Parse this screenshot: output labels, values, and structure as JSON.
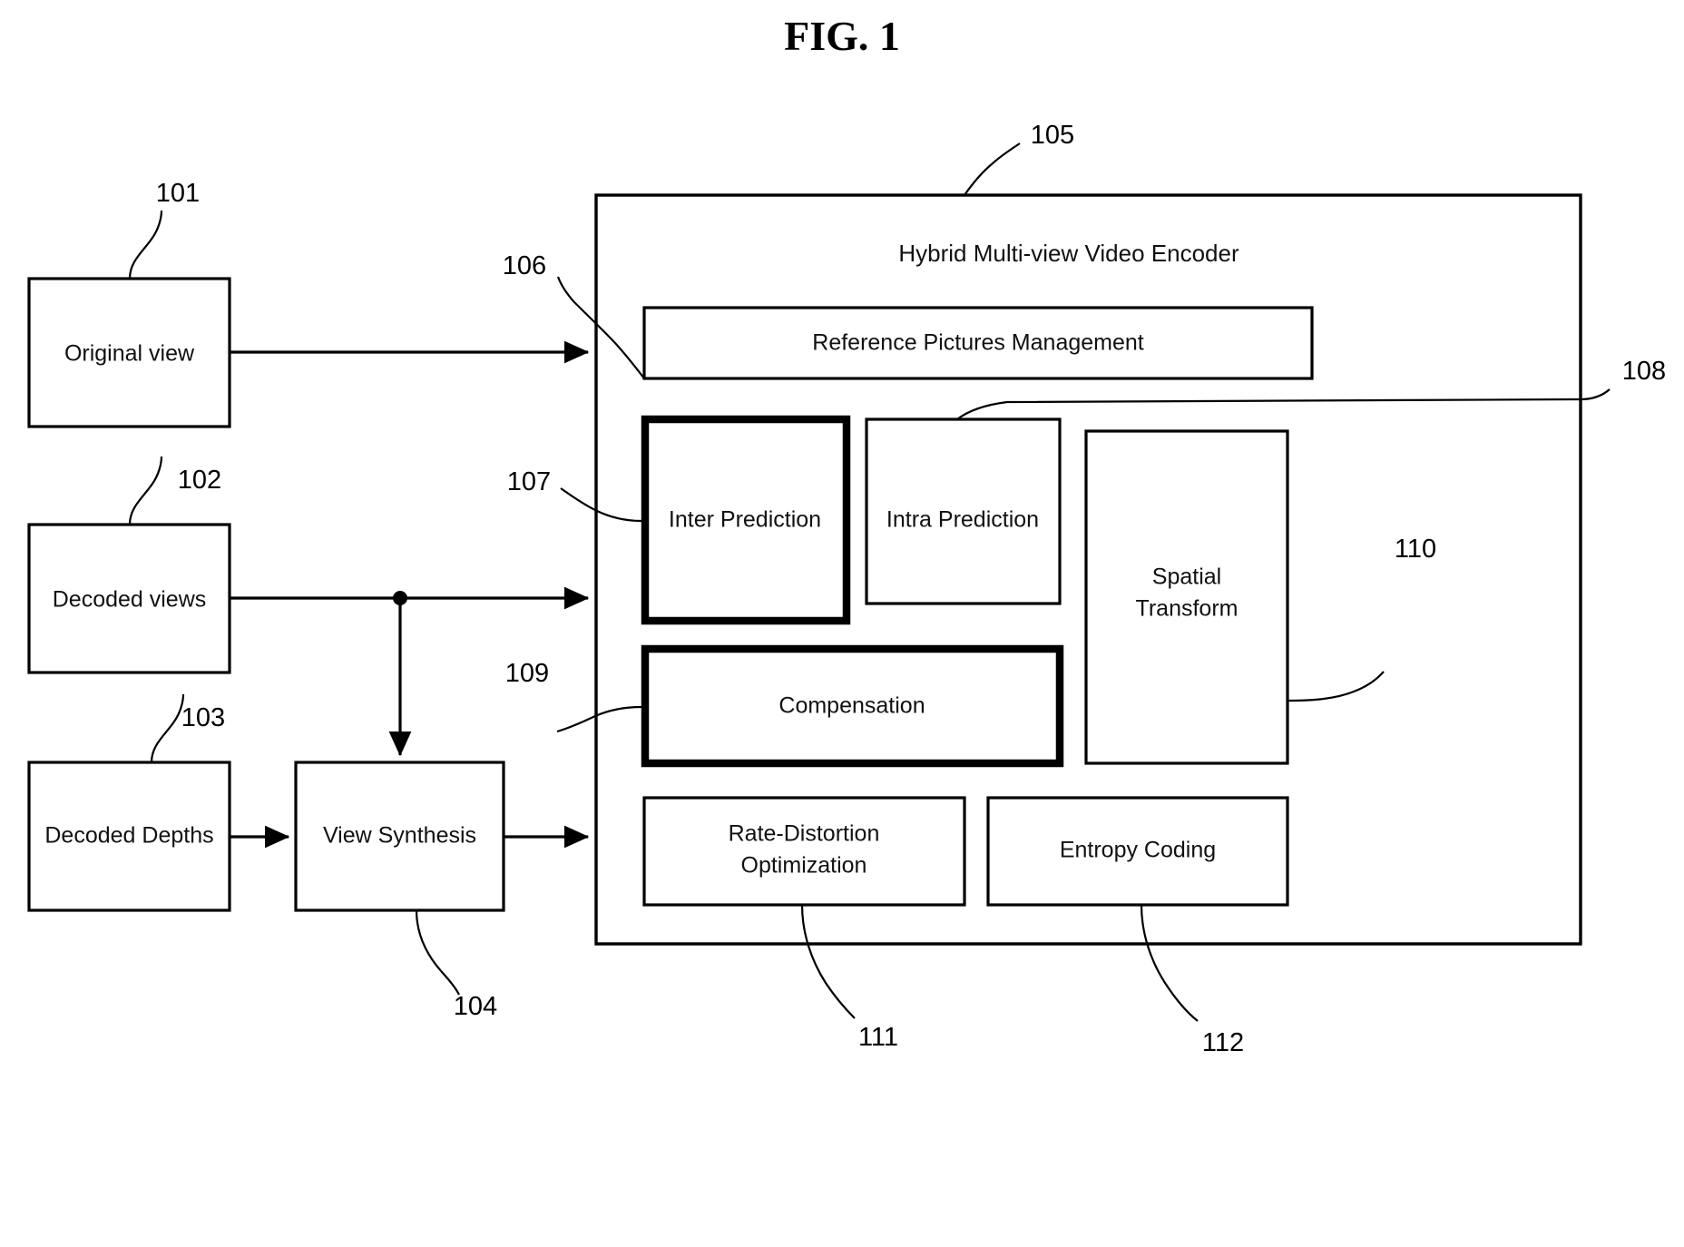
{
  "figure": {
    "title": "FIG. 1"
  },
  "inputs": [
    {
      "id": "original-view",
      "label": "Original view",
      "ref": "101"
    },
    {
      "id": "decoded-views",
      "label": "Decoded views",
      "ref": "102"
    },
    {
      "id": "decoded-depths",
      "label": "Decoded Depths",
      "ref": "103"
    }
  ],
  "synthesis": {
    "label": "View Synthesis",
    "ref": "104"
  },
  "encoder": {
    "title": "Hybrid Multi-view Video Encoder",
    "ref": "105",
    "modules": [
      {
        "id": "reference-pictures-management",
        "label": "Reference Pictures Management",
        "ref": "106",
        "emphasis": "normal"
      },
      {
        "id": "inter-prediction",
        "label": "Inter Prediction",
        "ref": "107",
        "emphasis": "bold"
      },
      {
        "id": "intra-prediction",
        "label": "Intra Prediction",
        "ref": "108",
        "emphasis": "normal"
      },
      {
        "id": "compensation",
        "label": "Compensation",
        "ref": "109",
        "emphasis": "bold"
      },
      {
        "id": "spatial-transform",
        "label_line1": "Spatial",
        "label_line2": "Transform",
        "ref": "110",
        "emphasis": "normal"
      },
      {
        "id": "rate-distortion-optimization",
        "label_line1": "Rate-Distortion",
        "label_line2": "Optimization",
        "ref": "111",
        "emphasis": "normal"
      },
      {
        "id": "entropy-coding",
        "label": "Entropy Coding",
        "ref": "112",
        "emphasis": "normal"
      }
    ]
  },
  "colors": {
    "stroke": "#000000",
    "background": "#ffffff",
    "text": "#111111"
  }
}
